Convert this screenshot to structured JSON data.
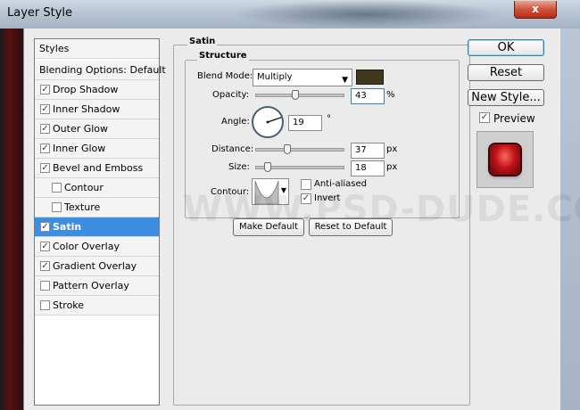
{
  "window": {
    "title": "Layer Style",
    "close_glyph": "x"
  },
  "styles_list": {
    "header": "Styles",
    "blending": "Blending Options: Default",
    "items": [
      {
        "label": "Drop Shadow",
        "checked": true,
        "sub": false
      },
      {
        "label": "Inner Shadow",
        "checked": true,
        "sub": false
      },
      {
        "label": "Outer Glow",
        "checked": true,
        "sub": false
      },
      {
        "label": "Inner Glow",
        "checked": true,
        "sub": false
      },
      {
        "label": "Bevel and Emboss",
        "checked": true,
        "sub": false
      },
      {
        "label": "Contour",
        "checked": false,
        "sub": true
      },
      {
        "label": "Texture",
        "checked": false,
        "sub": true
      },
      {
        "label": "Satin",
        "checked": true,
        "sub": false,
        "selected": true
      },
      {
        "label": "Color Overlay",
        "checked": true,
        "sub": false
      },
      {
        "label": "Gradient Overlay",
        "checked": true,
        "sub": false
      },
      {
        "label": "Pattern Overlay",
        "checked": false,
        "sub": false
      },
      {
        "label": "Stroke",
        "checked": false,
        "sub": false
      }
    ],
    "check_glyph": "✓"
  },
  "satin": {
    "title": "Satin",
    "structure_title": "Structure",
    "blend_mode_label": "Blend Mode:",
    "blend_mode_value": "Multiply",
    "blend_color": "#40371c",
    "opacity_label": "Opacity:",
    "opacity_value": "43",
    "opacity_unit": "%",
    "opacity_fraction": 0.43,
    "angle_label": "Angle:",
    "angle_value": "19",
    "angle_unit": "°",
    "distance_label": "Distance:",
    "distance_value": "37",
    "distance_unit": "px",
    "size_label": "Size:",
    "size_value": "18",
    "size_unit": "px",
    "contour_label": "Contour:",
    "anti_aliased_label": "Anti-aliased",
    "anti_aliased": false,
    "invert_label": "Invert",
    "invert": true,
    "make_default_label": "Make Default",
    "reset_default_label": "Reset to Default"
  },
  "actions": {
    "ok_label": "OK",
    "reset_label": "Reset",
    "new_style_label": "New Style...",
    "preview_label": "Preview",
    "preview_checked": true
  },
  "watermark": "WWW.PSD-DUDE.COM",
  "colors": {
    "selection": "#3d8ee0",
    "accent_border": "#3c7fb1",
    "preview_red": "#c0141a"
  }
}
